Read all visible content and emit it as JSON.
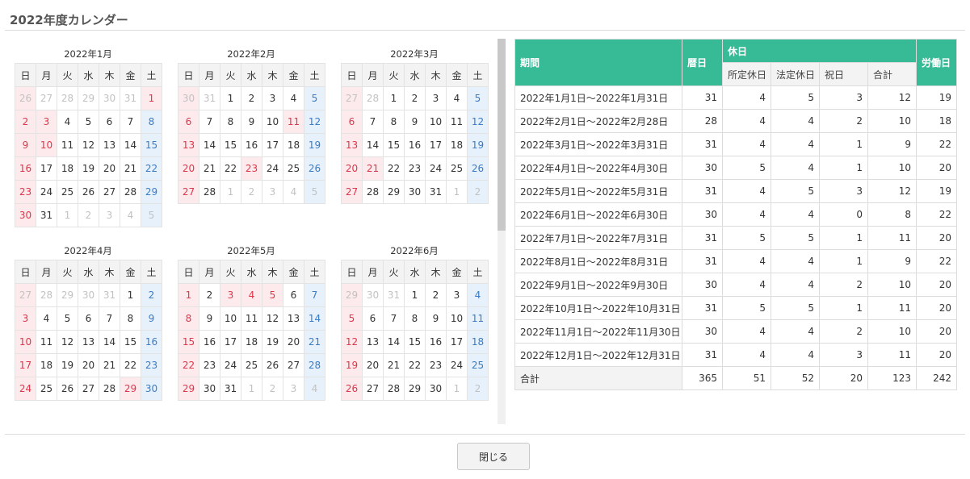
{
  "title": "2022年度カレンダー",
  "weekdays": [
    "日",
    "月",
    "火",
    "水",
    "木",
    "金",
    "土"
  ],
  "months": [
    {
      "title": "2022年1月",
      "weeks": [
        [
          [
            "26",
            "o"
          ],
          [
            "27",
            "o"
          ],
          [
            "28",
            "o"
          ],
          [
            "29",
            "o"
          ],
          [
            "30",
            "o"
          ],
          [
            "31",
            "o"
          ],
          [
            "1",
            "h"
          ]
        ],
        [
          [
            "2",
            "s"
          ],
          [
            "3",
            "h"
          ],
          [
            "4",
            ""
          ],
          [
            "5",
            ""
          ],
          [
            "6",
            ""
          ],
          [
            "7",
            ""
          ],
          [
            "8",
            "t"
          ]
        ],
        [
          [
            "9",
            "s"
          ],
          [
            "10",
            "h"
          ],
          [
            "11",
            ""
          ],
          [
            "12",
            ""
          ],
          [
            "13",
            ""
          ],
          [
            "14",
            ""
          ],
          [
            "15",
            "t"
          ]
        ],
        [
          [
            "16",
            "s"
          ],
          [
            "17",
            ""
          ],
          [
            "18",
            ""
          ],
          [
            "19",
            ""
          ],
          [
            "20",
            ""
          ],
          [
            "21",
            ""
          ],
          [
            "22",
            "t"
          ]
        ],
        [
          [
            "23",
            "s"
          ],
          [
            "24",
            ""
          ],
          [
            "25",
            ""
          ],
          [
            "26",
            ""
          ],
          [
            "27",
            ""
          ],
          [
            "28",
            ""
          ],
          [
            "29",
            "t"
          ]
        ],
        [
          [
            "30",
            "s"
          ],
          [
            "31",
            ""
          ],
          [
            "1",
            "o"
          ],
          [
            "2",
            "o"
          ],
          [
            "3",
            "o"
          ],
          [
            "4",
            "o"
          ],
          [
            "5",
            "o"
          ]
        ]
      ]
    },
    {
      "title": "2022年2月",
      "weeks": [
        [
          [
            "30",
            "o"
          ],
          [
            "31",
            "o"
          ],
          [
            "1",
            ""
          ],
          [
            "2",
            ""
          ],
          [
            "3",
            ""
          ],
          [
            "4",
            ""
          ],
          [
            "5",
            "t"
          ]
        ],
        [
          [
            "6",
            "s"
          ],
          [
            "7",
            ""
          ],
          [
            "8",
            ""
          ],
          [
            "9",
            ""
          ],
          [
            "10",
            ""
          ],
          [
            "11",
            "h"
          ],
          [
            "12",
            "t"
          ]
        ],
        [
          [
            "13",
            "s"
          ],
          [
            "14",
            ""
          ],
          [
            "15",
            ""
          ],
          [
            "16",
            ""
          ],
          [
            "17",
            ""
          ],
          [
            "18",
            ""
          ],
          [
            "19",
            "t"
          ]
        ],
        [
          [
            "20",
            "s"
          ],
          [
            "21",
            ""
          ],
          [
            "22",
            ""
          ],
          [
            "23",
            "h"
          ],
          [
            "24",
            ""
          ],
          [
            "25",
            ""
          ],
          [
            "26",
            "t"
          ]
        ],
        [
          [
            "27",
            "s"
          ],
          [
            "28",
            ""
          ],
          [
            "1",
            "o"
          ],
          [
            "2",
            "o"
          ],
          [
            "3",
            "o"
          ],
          [
            "4",
            "o"
          ],
          [
            "5",
            "o"
          ]
        ]
      ]
    },
    {
      "title": "2022年3月",
      "weeks": [
        [
          [
            "27",
            "o"
          ],
          [
            "28",
            "o"
          ],
          [
            "1",
            ""
          ],
          [
            "2",
            ""
          ],
          [
            "3",
            ""
          ],
          [
            "4",
            ""
          ],
          [
            "5",
            "t"
          ]
        ],
        [
          [
            "6",
            "s"
          ],
          [
            "7",
            ""
          ],
          [
            "8",
            ""
          ],
          [
            "9",
            ""
          ],
          [
            "10",
            ""
          ],
          [
            "11",
            ""
          ],
          [
            "12",
            "t"
          ]
        ],
        [
          [
            "13",
            "s"
          ],
          [
            "14",
            ""
          ],
          [
            "15",
            ""
          ],
          [
            "16",
            ""
          ],
          [
            "17",
            ""
          ],
          [
            "18",
            ""
          ],
          [
            "19",
            "t"
          ]
        ],
        [
          [
            "20",
            "s"
          ],
          [
            "21",
            "h"
          ],
          [
            "22",
            ""
          ],
          [
            "23",
            ""
          ],
          [
            "24",
            ""
          ],
          [
            "25",
            ""
          ],
          [
            "26",
            "t"
          ]
        ],
        [
          [
            "27",
            "s"
          ],
          [
            "28",
            ""
          ],
          [
            "29",
            ""
          ],
          [
            "30",
            ""
          ],
          [
            "31",
            ""
          ],
          [
            "1",
            "o"
          ],
          [
            "2",
            "o"
          ]
        ]
      ]
    },
    {
      "title": "2022年4月",
      "weeks": [
        [
          [
            "27",
            "o"
          ],
          [
            "28",
            "o"
          ],
          [
            "29",
            "o"
          ],
          [
            "30",
            "o"
          ],
          [
            "31",
            "o"
          ],
          [
            "1",
            ""
          ],
          [
            "2",
            "t"
          ]
        ],
        [
          [
            "3",
            "s"
          ],
          [
            "4",
            ""
          ],
          [
            "5",
            ""
          ],
          [
            "6",
            ""
          ],
          [
            "7",
            ""
          ],
          [
            "8",
            ""
          ],
          [
            "9",
            "t"
          ]
        ],
        [
          [
            "10",
            "s"
          ],
          [
            "11",
            ""
          ],
          [
            "12",
            ""
          ],
          [
            "13",
            ""
          ],
          [
            "14",
            ""
          ],
          [
            "15",
            ""
          ],
          [
            "16",
            "t"
          ]
        ],
        [
          [
            "17",
            "s"
          ],
          [
            "18",
            ""
          ],
          [
            "19",
            ""
          ],
          [
            "20",
            ""
          ],
          [
            "21",
            ""
          ],
          [
            "22",
            ""
          ],
          [
            "23",
            "t"
          ]
        ],
        [
          [
            "24",
            "s"
          ],
          [
            "25",
            ""
          ],
          [
            "26",
            ""
          ],
          [
            "27",
            ""
          ],
          [
            "28",
            ""
          ],
          [
            "29",
            "h"
          ],
          [
            "30",
            "t"
          ]
        ]
      ]
    },
    {
      "title": "2022年5月",
      "weeks": [
        [
          [
            "1",
            "s"
          ],
          [
            "2",
            ""
          ],
          [
            "3",
            "h"
          ],
          [
            "4",
            "h"
          ],
          [
            "5",
            "h"
          ],
          [
            "6",
            ""
          ],
          [
            "7",
            "t"
          ]
        ],
        [
          [
            "8",
            "s"
          ],
          [
            "9",
            ""
          ],
          [
            "10",
            ""
          ],
          [
            "11",
            ""
          ],
          [
            "12",
            ""
          ],
          [
            "13",
            ""
          ],
          [
            "14",
            "t"
          ]
        ],
        [
          [
            "15",
            "s"
          ],
          [
            "16",
            ""
          ],
          [
            "17",
            ""
          ],
          [
            "18",
            ""
          ],
          [
            "19",
            ""
          ],
          [
            "20",
            ""
          ],
          [
            "21",
            "t"
          ]
        ],
        [
          [
            "22",
            "s"
          ],
          [
            "23",
            ""
          ],
          [
            "24",
            ""
          ],
          [
            "25",
            ""
          ],
          [
            "26",
            ""
          ],
          [
            "27",
            ""
          ],
          [
            "28",
            "t"
          ]
        ],
        [
          [
            "29",
            "s"
          ],
          [
            "30",
            ""
          ],
          [
            "31",
            ""
          ],
          [
            "1",
            "o"
          ],
          [
            "2",
            "o"
          ],
          [
            "3",
            "o"
          ],
          [
            "4",
            "o"
          ]
        ]
      ]
    },
    {
      "title": "2022年6月",
      "weeks": [
        [
          [
            "29",
            "o"
          ],
          [
            "30",
            "o"
          ],
          [
            "31",
            "o"
          ],
          [
            "1",
            ""
          ],
          [
            "2",
            ""
          ],
          [
            "3",
            ""
          ],
          [
            "4",
            "t"
          ]
        ],
        [
          [
            "5",
            "s"
          ],
          [
            "6",
            ""
          ],
          [
            "7",
            ""
          ],
          [
            "8",
            ""
          ],
          [
            "9",
            ""
          ],
          [
            "10",
            ""
          ],
          [
            "11",
            "t"
          ]
        ],
        [
          [
            "12",
            "s"
          ],
          [
            "13",
            ""
          ],
          [
            "14",
            ""
          ],
          [
            "15",
            ""
          ],
          [
            "16",
            ""
          ],
          [
            "17",
            ""
          ],
          [
            "18",
            "t"
          ]
        ],
        [
          [
            "19",
            "s"
          ],
          [
            "20",
            ""
          ],
          [
            "21",
            ""
          ],
          [
            "22",
            ""
          ],
          [
            "23",
            ""
          ],
          [
            "24",
            ""
          ],
          [
            "25",
            "t"
          ]
        ],
        [
          [
            "26",
            "s"
          ],
          [
            "27",
            ""
          ],
          [
            "28",
            ""
          ],
          [
            "29",
            ""
          ],
          [
            "30",
            ""
          ],
          [
            "1",
            "o"
          ],
          [
            "2",
            "o"
          ]
        ]
      ]
    }
  ],
  "summary": {
    "headers": {
      "period": "期間",
      "calendar_days": "暦日",
      "holidays": "休日",
      "scheduled": "所定休日",
      "legal": "法定休日",
      "national": "祝日",
      "subtotal": "合計",
      "working_days": "労働日"
    },
    "rows": [
      {
        "period": "2022年1月1日～2022年1月31日",
        "days": "31",
        "scheduled": "4",
        "legal": "5",
        "national": "3",
        "total": "12",
        "work": "19"
      },
      {
        "period": "2022年2月1日～2022年2月28日",
        "days": "28",
        "scheduled": "4",
        "legal": "4",
        "national": "2",
        "total": "10",
        "work": "18"
      },
      {
        "period": "2022年3月1日～2022年3月31日",
        "days": "31",
        "scheduled": "4",
        "legal": "4",
        "national": "1",
        "total": "9",
        "work": "22"
      },
      {
        "period": "2022年4月1日～2022年4月30日",
        "days": "30",
        "scheduled": "5",
        "legal": "4",
        "national": "1",
        "total": "10",
        "work": "20"
      },
      {
        "period": "2022年5月1日～2022年5月31日",
        "days": "31",
        "scheduled": "4",
        "legal": "5",
        "national": "3",
        "total": "12",
        "work": "19"
      },
      {
        "period": "2022年6月1日～2022年6月30日",
        "days": "30",
        "scheduled": "4",
        "legal": "4",
        "national": "0",
        "total": "8",
        "work": "22"
      },
      {
        "period": "2022年7月1日～2022年7月31日",
        "days": "31",
        "scheduled": "5",
        "legal": "5",
        "national": "1",
        "total": "11",
        "work": "20"
      },
      {
        "period": "2022年8月1日～2022年8月31日",
        "days": "31",
        "scheduled": "4",
        "legal": "4",
        "national": "1",
        "total": "9",
        "work": "22"
      },
      {
        "period": "2022年9月1日～2022年9月30日",
        "days": "30",
        "scheduled": "4",
        "legal": "4",
        "national": "2",
        "total": "10",
        "work": "20"
      },
      {
        "period": "2022年10月1日～2022年10月31日",
        "days": "31",
        "scheduled": "5",
        "legal": "5",
        "national": "1",
        "total": "11",
        "work": "20"
      },
      {
        "period": "2022年11月1日～2022年11月30日",
        "days": "30",
        "scheduled": "4",
        "legal": "4",
        "national": "2",
        "total": "10",
        "work": "20"
      },
      {
        "period": "2022年12月1日～2022年12月31日",
        "days": "31",
        "scheduled": "4",
        "legal": "4",
        "national": "3",
        "total": "11",
        "work": "20"
      }
    ],
    "total": {
      "period": "合計",
      "days": "365",
      "scheduled": "51",
      "legal": "52",
      "national": "20",
      "total": "123",
      "work": "242"
    }
  },
  "close_label": "閉じる",
  "colors": {
    "header_green": "#37bb97",
    "sunday_red": "#e0354a",
    "saturday_blue": "#3a7cc8"
  }
}
